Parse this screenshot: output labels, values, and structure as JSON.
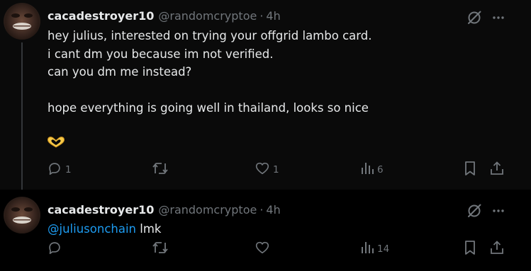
{
  "colors": {
    "background": "#000000",
    "post_highlight": "#0a0a0a",
    "text_primary": "#e7e9ea",
    "text_secondary": "#71767b",
    "mention": "#1d9bf0",
    "thread_line": "#333639",
    "heart_hands_emoji": "#f7c948"
  },
  "posts": [
    {
      "display_name": "cacadestroyer10",
      "handle": "@randomcryptoe",
      "separator": "·",
      "time": "4h",
      "avatar_icon": "avatar-dark-face",
      "grok_icon": "grok-icon",
      "more_icon": "more-icon",
      "lines": [
        "hey julius, interested on trying your offgrid lambo card.",
        "i cant dm you because im not verified.",
        "can you dm me instead?",
        "",
        "hope everything is going well in thailand, looks so nice"
      ],
      "emoji": "heart-hands-emoji",
      "actions": {
        "reply_count": "1",
        "retweet_count": "",
        "like_count": "1",
        "views_count": "6"
      }
    },
    {
      "display_name": "cacadestroyer10",
      "handle": "@randomcryptoe",
      "separator": "·",
      "time": "4h",
      "avatar_icon": "avatar-dark-face",
      "grok_icon": "grok-icon",
      "more_icon": "more-icon",
      "mention": "@juliusonchain",
      "text": " lmk",
      "actions": {
        "reply_count": "",
        "retweet_count": "",
        "like_count": "",
        "views_count": "14"
      }
    }
  ]
}
